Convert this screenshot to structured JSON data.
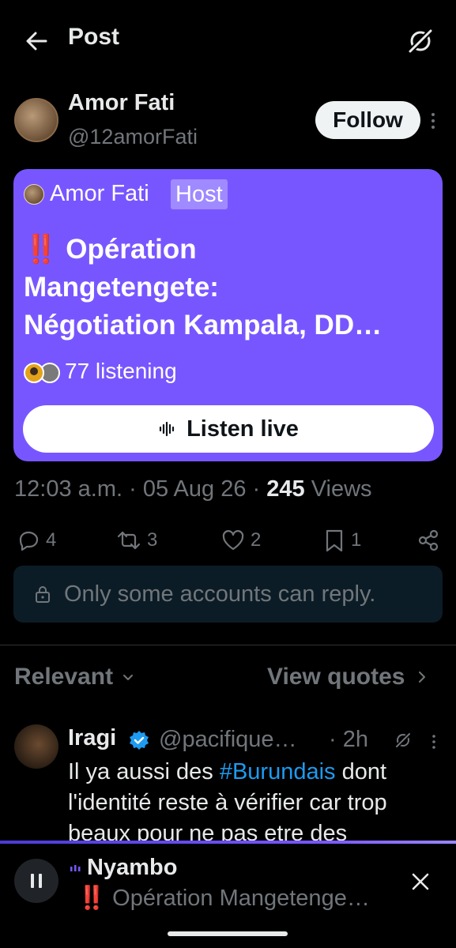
{
  "header": {
    "title": "Post",
    "back_icon": "arrow-left-icon",
    "grok_icon": "grok-icon"
  },
  "author": {
    "name": "Amor Fati",
    "handle": "@12amorFati",
    "follow_label": "Follow"
  },
  "space": {
    "host_name": "Amor Fati",
    "host_badge": "Host",
    "title_line1": "‼️ Opération",
    "title_line2": "Mangetengete:",
    "title_line3": "Négotiation Kampala, DD…",
    "listening": "77 listening",
    "listen_label": "Listen live",
    "background": "#7856ff"
  },
  "meta": {
    "time": "12:03 a.m.",
    "sep1": "·",
    "date": "05 Aug 26",
    "sep2": "·",
    "views_count": "245",
    "views_label": "Views"
  },
  "actions": {
    "replies": "4",
    "reposts": "3",
    "likes": "2",
    "bookmarks": "1"
  },
  "restricted": {
    "text": "Only some accounts can reply."
  },
  "sort": {
    "relevant_label": "Relevant",
    "view_quotes_label": "View quotes"
  },
  "reply": {
    "name": "Iragi",
    "handle": "@pacifique…",
    "time": "· 2h",
    "text_before": "Il ya aussi des ",
    "hashtag": "#Burundais",
    "text_after": " dont l'identité reste à vérifier car trop beaux pour ne pas etre des"
  },
  "player": {
    "host": "Nyambo",
    "title": "‼️ Opération Mangetenge…",
    "accent": "#7856ff"
  }
}
